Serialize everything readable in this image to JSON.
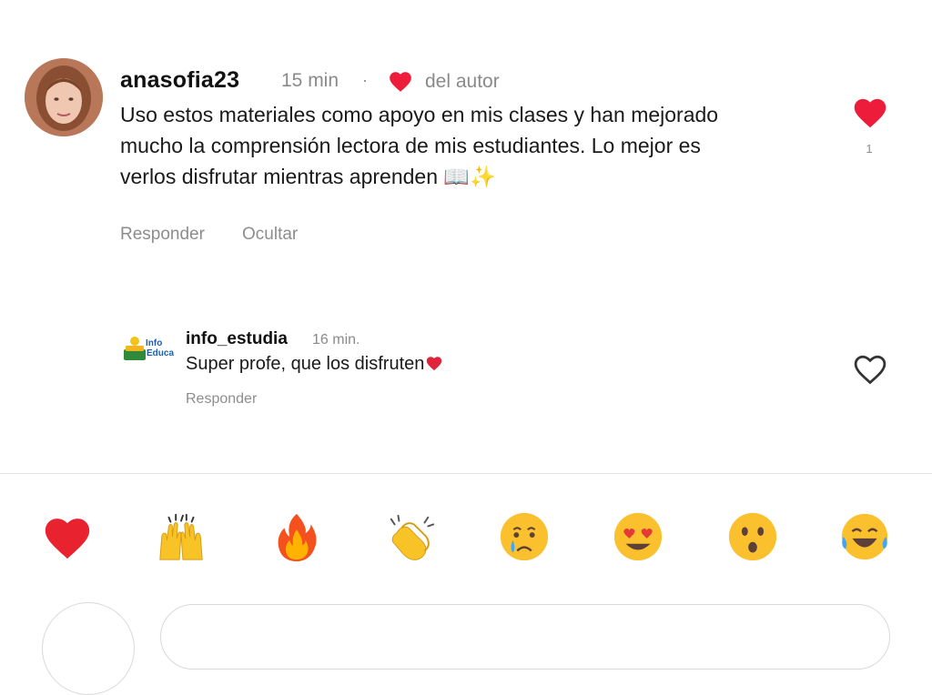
{
  "main_comment": {
    "username": "anasofia23",
    "time": "15 min",
    "separator": "·",
    "author_label": "del autor",
    "text": "Uso estos materiales como apoyo en mis clases y han mejorado mucho la comprensión lectora de mis estudiantes. Lo mejor es verlos disfrutar mientras aprenden 📖✨",
    "reply_label": "Responder",
    "hide_label": "Ocultar",
    "like_count": "1",
    "heart_color": "#ed1c3a"
  },
  "reply_comment": {
    "username": "info_estudia",
    "time": "16 min.",
    "text": "Super profe, que los disfruten",
    "reply_label": "Responder",
    "logo_text_top": "Info",
    "logo_text_bottom": "Educa"
  },
  "reactions": [
    {
      "emoji": "❤️",
      "name": "red-heart"
    },
    {
      "emoji": "🙌",
      "name": "raising-hands"
    },
    {
      "emoji": "🔥",
      "name": "fire"
    },
    {
      "emoji": "👏",
      "name": "clapping-hands"
    },
    {
      "emoji": "😢",
      "name": "crying-face"
    },
    {
      "emoji": "😍",
      "name": "heart-eyes"
    },
    {
      "emoji": "😮",
      "name": "surprised-face"
    },
    {
      "emoji": "😂",
      "name": "laughing-face"
    }
  ]
}
